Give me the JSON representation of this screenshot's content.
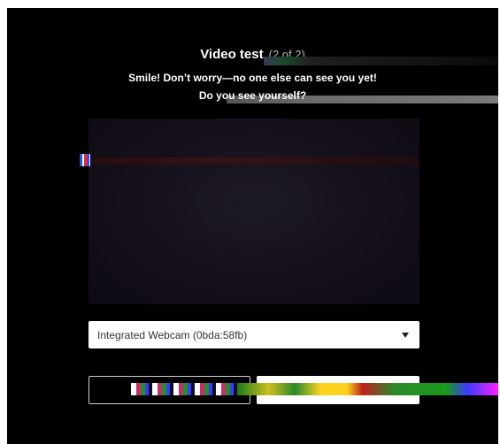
{
  "dialog": {
    "title": "Video test",
    "step": "(2 of 2)",
    "subtitle": "Smile! Don’t worry—no one else can see you yet!",
    "question": "Do you see yourself?"
  },
  "camera_select": {
    "selected": "Integrated Webcam (0bda:58fb)"
  },
  "buttons": {
    "secondary_label": "",
    "primary_label": ""
  },
  "colors": {
    "background": "#000000",
    "video_bg": "#140f1a",
    "select_bg": "#ffffff",
    "text": "#ffffff"
  },
  "icons": {
    "dropdown": "chevron-down-icon"
  }
}
